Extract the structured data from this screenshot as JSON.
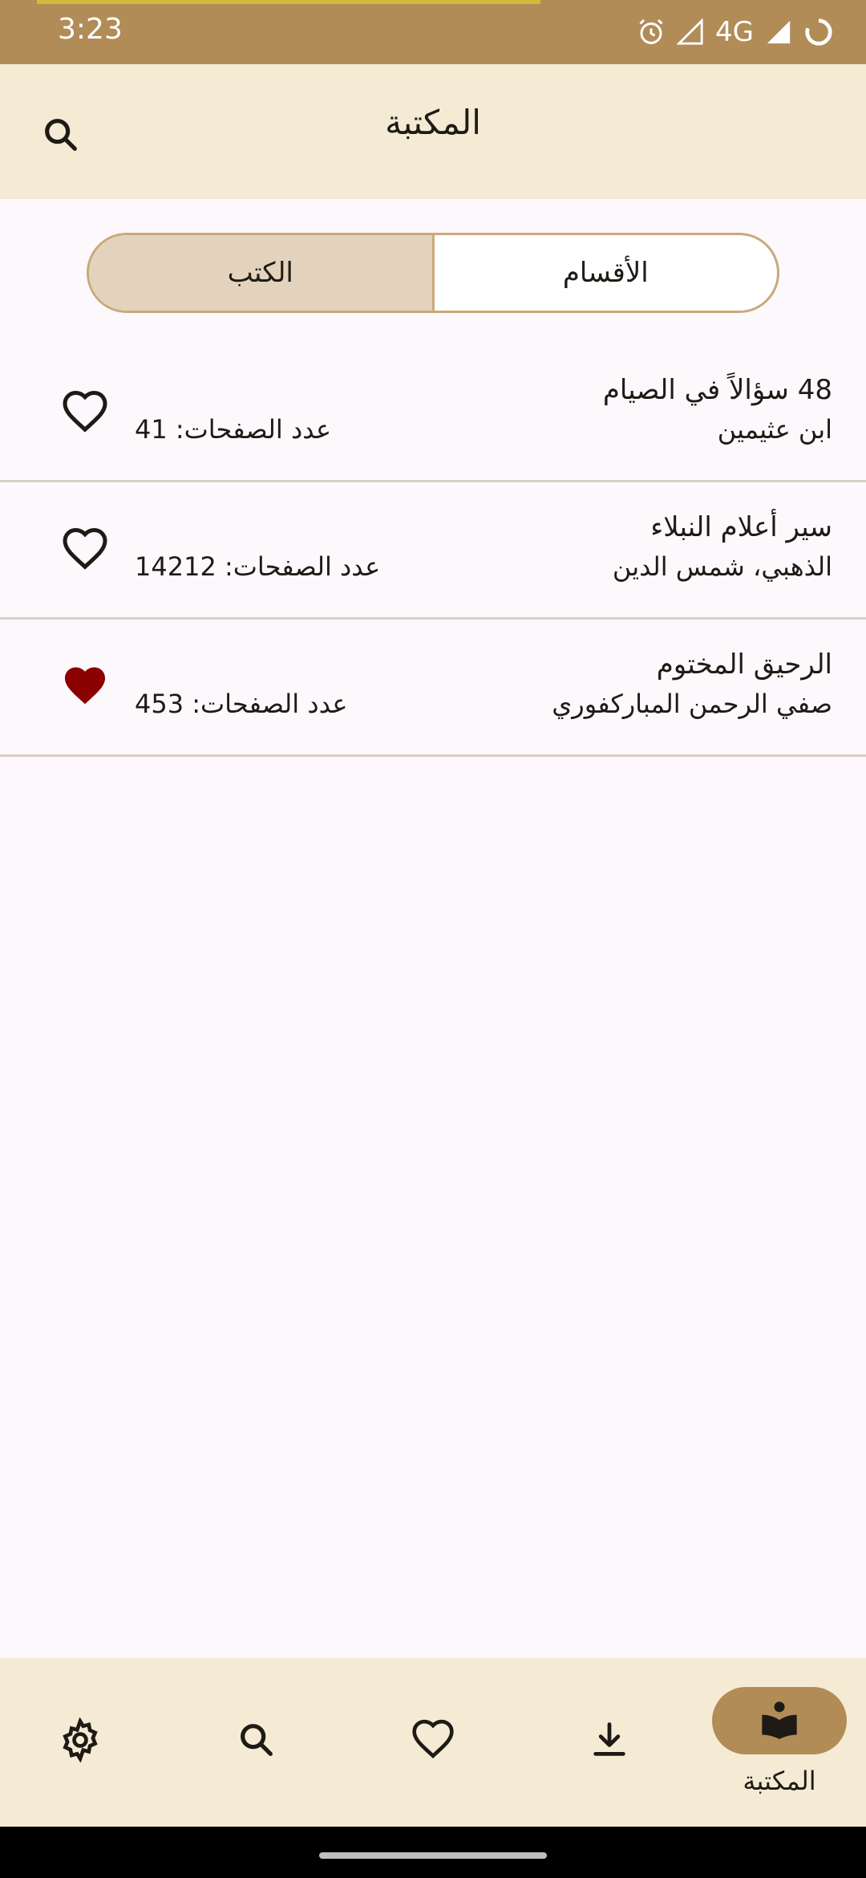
{
  "status_bar": {
    "time": "3:23",
    "network": "4G",
    "icons": [
      "alarm-icon",
      "signal-icon",
      "signal-icon",
      "loading-icon"
    ]
  },
  "app_bar": {
    "title": "المكتبة",
    "search_icon": "search-icon"
  },
  "tabs": [
    {
      "label": "الأقسام",
      "selected": false
    },
    {
      "label": "الكتب",
      "selected": true
    }
  ],
  "books": [
    {
      "title": "48 سؤالاً في الصيام",
      "author": "ابن عثيمين",
      "pages_label": "عدد الصفحات: 41",
      "favorite": false
    },
    {
      "title": "سير أعلام النبلاء",
      "author": "الذهبي، شمس الدين",
      "pages_label": "عدد الصفحات: 14212",
      "favorite": false
    },
    {
      "title": "الرحيق المختوم",
      "author": "صفي الرحمن المباركفوري",
      "pages_label": "عدد الصفحات: 453",
      "favorite": true
    }
  ],
  "bottom_nav": {
    "items": [
      {
        "icon": "book-icon",
        "label": "المكتبة",
        "active": true
      },
      {
        "icon": "download-icon",
        "label": "",
        "active": false
      },
      {
        "icon": "heart-icon",
        "label": "",
        "active": false
      },
      {
        "icon": "search-icon",
        "label": "",
        "active": false
      },
      {
        "icon": "settings-icon",
        "label": "",
        "active": false
      }
    ]
  },
  "colors": {
    "status_bar": "#B18C57",
    "app_bar": "#F5EBD5",
    "accent": "#B18C57",
    "tab_selected": "#E3D3BC",
    "favorite": "#8B0000",
    "background": "#FDF8FC"
  }
}
